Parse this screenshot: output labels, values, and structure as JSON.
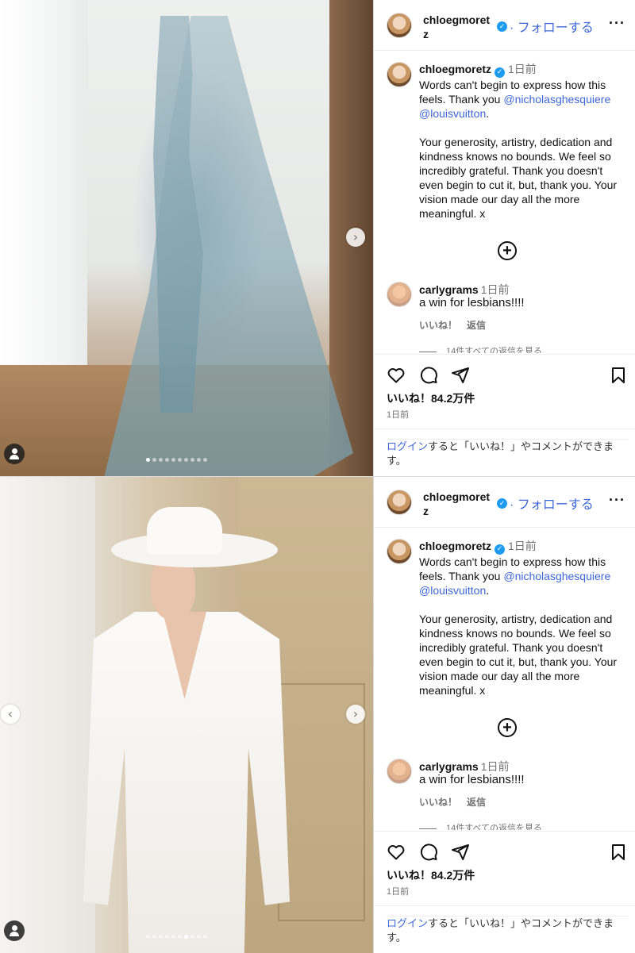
{
  "posts": [
    {
      "header": {
        "username": "chloegmoretz",
        "follow": "フォローする"
      },
      "caption": {
        "username": "chloegmoretz",
        "time": "1日前",
        "para1_prefix": "Words can't begin to express how this feels. Thank you ",
        "mention1": "@nicholasghesquiere",
        "mention2": "@louisvuitton",
        "para1_suffix": ".",
        "para2": "Your generosity, artistry, dedication and kindness knows no bounds. We feel so incredibly grateful. Thank you doesn't even begin to cut it, but, thank you. Your vision made our day all the more meaningful. x"
      },
      "comment": {
        "username": "carlygrams",
        "time": "1日前",
        "text": "a win for lesbians!!!!",
        "like": "いいね！",
        "reply": "返信",
        "view_replies": "14件すべての返信を見る"
      },
      "likes": "いいね！84.2万件",
      "date": "1日前",
      "login_link": "ログイン",
      "login_text": "すると「いいね！」やコメントができます。",
      "carousel": {
        "count": 10,
        "active": 0
      }
    },
    {
      "header": {
        "username": "chloegmoretz",
        "follow": "フォローする"
      },
      "caption": {
        "username": "chloegmoretz",
        "time": "1日前",
        "para1_prefix": "Words can't begin to express how this feels. Thank you ",
        "mention1": "@nicholasghesquiere",
        "mention2": "@louisvuitton",
        "para1_suffix": ".",
        "para2": "Your generosity, artistry, dedication and kindness knows no bounds. We feel so incredibly grateful. Thank you doesn't even begin to cut it, but, thank you. Your vision made our day all the more meaningful. x"
      },
      "comment": {
        "username": "carlygrams",
        "time": "1日前",
        "text": "a win for lesbians!!!!",
        "like": "いいね！",
        "reply": "返信",
        "view_replies": "14件すべての返信を見る"
      },
      "likes": "いいね！84.2万件",
      "date": "1日前",
      "login_link": "ログイン",
      "login_text": "すると「いいね！」やコメントができます。",
      "carousel": {
        "count": 10,
        "active": 6
      }
    }
  ],
  "colors": {
    "link": "#3f67d8",
    "verified": "#1d9bf0",
    "muted": "#737373",
    "border": "#dbdbdb"
  },
  "icons": [
    "heart-icon",
    "comment-icon",
    "share-icon",
    "bookmark-icon",
    "plus-icon",
    "more-icon",
    "verified-icon",
    "user-tag-icon",
    "chevron-right-icon",
    "chevron-left-icon"
  ]
}
